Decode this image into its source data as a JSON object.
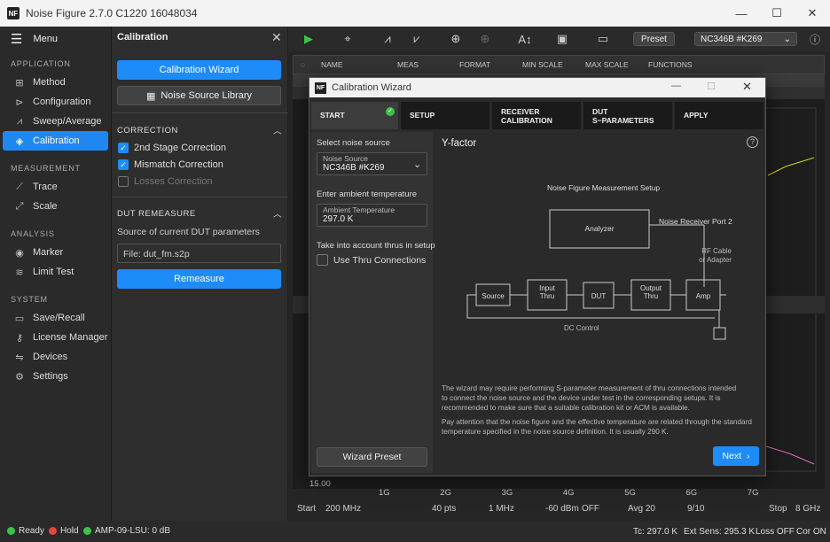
{
  "window": {
    "title": "Noise Figure 2.7.0 C1220 16048034",
    "logo": "NF"
  },
  "nav": {
    "menu_label": "Menu",
    "sections": [
      {
        "title": "APPLICATION",
        "items": [
          {
            "label": "Method",
            "icon": "method-icon"
          },
          {
            "label": "Configuration",
            "icon": "configuration-icon"
          },
          {
            "label": "Sweep/Average",
            "icon": "sweep-icon"
          },
          {
            "label": "Calibration",
            "icon": "calibration-icon",
            "active": true
          }
        ]
      },
      {
        "title": "MEASUREMENT",
        "items": [
          {
            "label": "Trace",
            "icon": "trace-icon"
          },
          {
            "label": "Scale",
            "icon": "scale-icon"
          }
        ]
      },
      {
        "title": "ANALYSIS",
        "items": [
          {
            "label": "Marker",
            "icon": "marker-icon"
          },
          {
            "label": "Limit Test",
            "icon": "limit-test-icon"
          }
        ]
      },
      {
        "title": "SYSTEM",
        "items": [
          {
            "label": "Save/Recall",
            "icon": "folder-icon"
          },
          {
            "label": "License Manager",
            "icon": "key-icon"
          },
          {
            "label": "Devices",
            "icon": "devices-icon"
          },
          {
            "label": "Settings",
            "icon": "gear-icon"
          }
        ]
      }
    ]
  },
  "calibration": {
    "title": "Calibration",
    "wizard_button": "Calibration Wizard",
    "library_button": "Noise Source Library",
    "correction_header": "CORRECTION",
    "checks": [
      {
        "label": "2nd Stage Correction",
        "checked": true
      },
      {
        "label": "Mismatch Correction",
        "checked": true
      },
      {
        "label": "Losses Correction",
        "checked": false
      }
    ],
    "dut_header": "DUT REMEASURE",
    "dut_source_label": "Source of current DUT parameters",
    "dut_file": "File: dut_fm.s2p",
    "remeasure_button": "Remeasure"
  },
  "toolbar": {
    "preset_label": "Preset",
    "device": "NC346B #K269"
  },
  "trace_table": {
    "headers": [
      "NAME",
      "MEAS",
      "FORMAT",
      "MIN SCALE",
      "MAX SCALE",
      "FUNCTIONS"
    ]
  },
  "chart": {
    "y_bottom": "15.00",
    "x_ticks": [
      "1G",
      "2G",
      "3G",
      "4G",
      "5G",
      "6G",
      "7G"
    ]
  },
  "sweep": {
    "start_label": "Start",
    "start": "200 MHz",
    "points": "40 pts",
    "step": "1 MHz",
    "power": "-60 dBm",
    "power_state": "OFF",
    "avg": "Avg 20",
    "avg_count": "9/10",
    "stop_label": "Stop",
    "stop": "8 GHz"
  },
  "status": {
    "ready": "Ready",
    "hold": "Hold",
    "amp": "AMP-09-LSU: 0 dB",
    "tc": "Tc: 297.0 K",
    "ext": "Ext Sens: 295.3 K",
    "loss": "Loss OFF",
    "cor": "Cor ON",
    "colors": {
      "ready": "#3cc24a",
      "hold": "#e5483b",
      "amp": "#3cc24a"
    }
  },
  "dialog": {
    "title": "Calibration Wizard",
    "tabs": [
      "START",
      "SETUP",
      "RECEIVER\nCALIBRATION",
      "DUT\nS−PARAMETERS",
      "APPLY"
    ],
    "select_source_label": "Select noise source",
    "noise_source_caption": "Noise Source",
    "noise_source_value": "NC346B #K269",
    "ambient_label": "Enter ambient temperature",
    "ambient_caption": "Ambient Temperature",
    "ambient_value": "297.0 K",
    "thru_label": "Take into account thrus in setups",
    "thru_check": "Use Thru Connections",
    "wizard_preset": "Wizard Preset",
    "heading": "Y-factor",
    "diagram": {
      "title": "Noise Figure Measurement Setup",
      "analyzer": "Analyzer",
      "port": "Noise Receiver Port 2",
      "cable": "RF Cable\nor Adapter",
      "blocks": [
        "Source",
        "Input\nThru",
        "DUT",
        "Output\nThru",
        "Amp"
      ],
      "dc": "DC Control"
    },
    "note1": "The wizard may require performing S-parameter measurement of thru connections intended to connect the noise source and the device under test in the corresponding setups. It is recommended to make sure that a suitable calibration kit or ACM is available.",
    "note2": "Pay attention that the noise figure and the effective temperature are related through the standard temperature specified in the noise source definition. It is usually 290 K.",
    "next": "Next"
  }
}
